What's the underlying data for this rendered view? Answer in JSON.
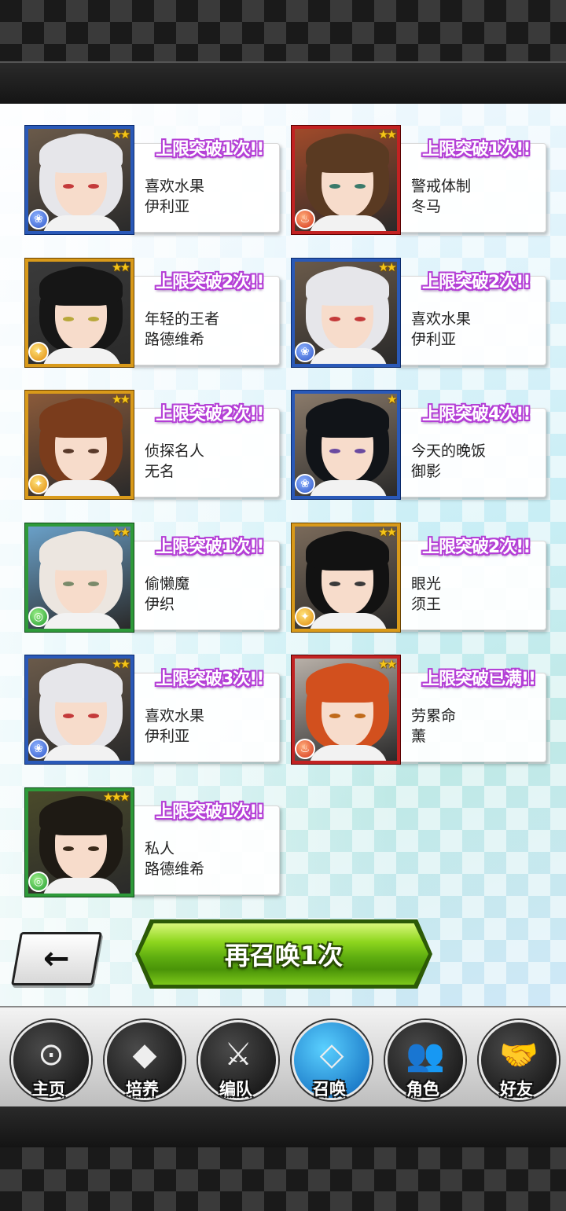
{
  "results": [
    {
      "badge": "上限突破1次!!",
      "title": "喜欢水果",
      "name": "伊利亚",
      "frame": "blue",
      "element": "blue",
      "stars": 2,
      "hair": "#e6e6ea",
      "eyes": "#c43a3a",
      "bg": "#6a5a4a"
    },
    {
      "badge": "上限突破1次!!",
      "title": "警戒体制",
      "name": "冬马",
      "frame": "red",
      "element": "red",
      "stars": 2,
      "hair": "#5a3a22",
      "eyes": "#3a7a6a",
      "bg": "#a04a2a"
    },
    {
      "badge": "上限突破2次!!",
      "title": "年轻的王者",
      "name": "路德维希",
      "frame": "yellow",
      "element": "yellow",
      "stars": 2,
      "hair": "#161616",
      "eyes": "#b8a83a",
      "bg": "#3a3a3a"
    },
    {
      "badge": "上限突破2次!!",
      "title": "喜欢水果",
      "name": "伊利亚",
      "frame": "blue",
      "element": "blue",
      "stars": 2,
      "hair": "#e6e6ea",
      "eyes": "#c43a3a",
      "bg": "#6a5a4a"
    },
    {
      "badge": "上限突破2次!!",
      "title": "侦探名人",
      "name": "无名",
      "frame": "yellow",
      "element": "yellow",
      "stars": 2,
      "hair": "#7a3c1c",
      "eyes": "#5a3a2a",
      "bg": "#8a5a3a"
    },
    {
      "badge": "上限突破4次!!",
      "title": "今天的晚饭",
      "name": "御影",
      "frame": "blue",
      "element": "blue",
      "stars": 1,
      "hair": "#111418",
      "eyes": "#6a4aa0",
      "bg": "#8a7a6a"
    },
    {
      "badge": "上限突破1次!!",
      "title": "偷懒魔",
      "name": "伊织",
      "frame": "green",
      "element": "green",
      "stars": 2,
      "hair": "#ece6e0",
      "eyes": "#7a8a6a",
      "bg": "#6aa0c8"
    },
    {
      "badge": "上限突破2次!!",
      "title": "眼光",
      "name": "须王",
      "frame": "yellow",
      "element": "yellow",
      "stars": 2,
      "hair": "#121212",
      "eyes": "#3a3a3a",
      "bg": "#7a6a5a"
    },
    {
      "badge": "上限突破3次!!",
      "title": "喜欢水果",
      "name": "伊利亚",
      "frame": "blue",
      "element": "blue",
      "stars": 2,
      "hair": "#e6e6ea",
      "eyes": "#c43a3a",
      "bg": "#6a5a4a"
    },
    {
      "badge": "上限突破已满!!",
      "title": "劳累命",
      "name": "薰",
      "frame": "red",
      "element": "red",
      "stars": 2,
      "hair": "#d2501e",
      "eyes": "#c06a1a",
      "bg": "#b8b0a8"
    },
    {
      "badge": "上限突破1次!!",
      "title": "私人",
      "name": "路德维希",
      "frame": "green",
      "element": "green",
      "stars": 3,
      "hair": "#1e1a14",
      "eyes": "#3a2a1a",
      "bg": "#4a4a2a"
    }
  ],
  "summon_again_label": "再召唤1次",
  "back_icon": "←",
  "tabs": [
    {
      "label": "主页",
      "icon": "apple-icon",
      "glyph": "⊙",
      "active": false
    },
    {
      "label": "培养",
      "icon": "gem-pile-icon",
      "glyph": "◆",
      "active": false
    },
    {
      "label": "编队",
      "icon": "crossed-swords-icon",
      "glyph": "⚔",
      "active": false
    },
    {
      "label": "召唤",
      "icon": "diamond-icon",
      "glyph": "◇",
      "active": true
    },
    {
      "label": "角色",
      "icon": "people-icon",
      "glyph": "👥",
      "active": false
    },
    {
      "label": "好友",
      "icon": "handshake-icon",
      "glyph": "🤝",
      "active": false
    }
  ],
  "colors": {
    "badge_outline": "#b43fd6",
    "frame_blue": "#2a59b8",
    "frame_red": "#c22222",
    "frame_yellow": "#d99a1a",
    "frame_green": "#2e9a3a",
    "summon_green": "#5fae10",
    "active_tab": "#0a62b8"
  }
}
